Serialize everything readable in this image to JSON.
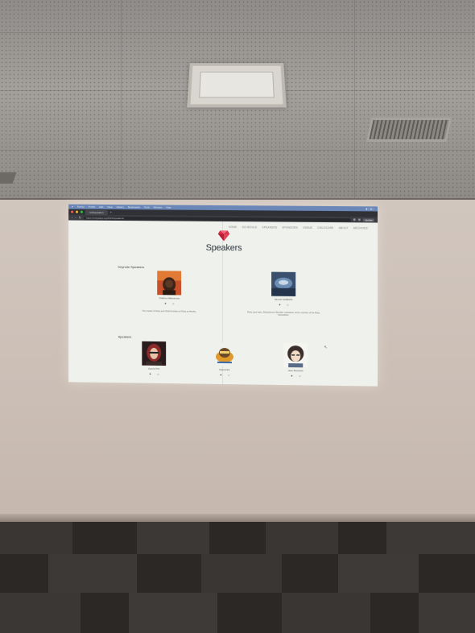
{
  "browser": {
    "menu_items": [
      "Firefox",
      "Profile",
      "Edit",
      "View",
      "History",
      "Bookmarks",
      "Tools",
      "Window",
      "Help"
    ],
    "tab_title": "nekbuppaken",
    "url": "https://rubykaigi.org/2023/speakers/",
    "update_label": "Update"
  },
  "site": {
    "nav": [
      "Home",
      "Schedule",
      "Speakers",
      "Sponsors",
      "Venue",
      "Childcare",
      "About",
      "Archives"
    ],
    "title": "Speakers",
    "keynote_heading": "Keynote Speakers",
    "speakers_heading": "Speakers",
    "keynote_speakers": [
      {
        "name": "Yukihiro Matsumoto",
        "desc": "The creator of Ruby and Chief Architect of Ruby at Heroku."
      },
      {
        "name": "Hiroshi SHIBATA",
        "desc": "Ruby core team, RubyGems & Bundler maintainer, and a member of the Ruby Association."
      }
    ],
    "speakers": [
      {
        "name": "Koichi ITO"
      },
      {
        "name": "hasumikin"
      },
      {
        "name": "Jean Boussier"
      }
    ]
  },
  "colors": {
    "accent": "#d8324b",
    "screen": "#eef1ec",
    "title_text": "#2f3742"
  }
}
